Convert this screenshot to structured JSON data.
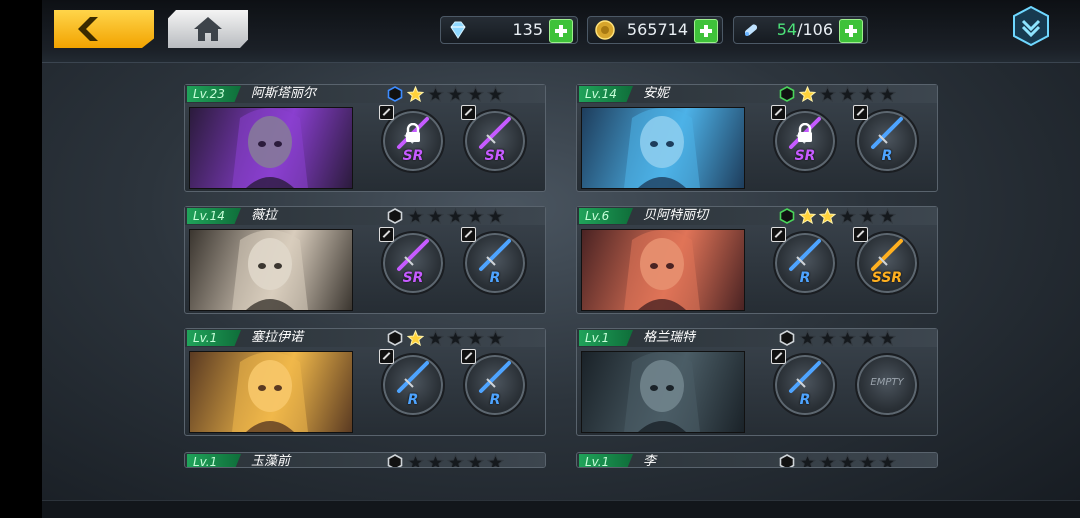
{
  "topbar": {
    "diamonds": "135",
    "gold": "565714",
    "capacity_current": "54",
    "capacity_max": "/106"
  },
  "colors": {
    "accent": "#f2a300",
    "level_green": "#20a35a",
    "plus_green": "#3fc23a"
  },
  "icons": [
    "back-arrow-icon",
    "home-icon",
    "diamond-icon",
    "gold-coin-icon",
    "capacity-icon",
    "plus-icon",
    "menu-chevron-icon",
    "lock-icon",
    "edit-icon",
    "star-icon",
    "element-hexagon-icon"
  ],
  "cards": [
    {
      "level": "Lv.23",
      "name": "阿斯塔丽尔",
      "stars": 1,
      "element_color": "#3d8cff",
      "slots": [
        {
          "rarity": "SR",
          "locked": true
        },
        {
          "rarity": "SR",
          "locked": false
        }
      ]
    },
    {
      "level": "Lv.14",
      "name": "安妮",
      "stars": 1,
      "element_color": "#4ad45a",
      "slots": [
        {
          "rarity": "SR",
          "locked": true
        },
        {
          "rarity": "R",
          "locked": false
        }
      ]
    },
    {
      "level": "Lv.14",
      "name": "薇拉",
      "stars": 0,
      "element_color": "#222",
      "slots": [
        {
          "rarity": "SR",
          "locked": false
        },
        {
          "rarity": "R",
          "locked": false
        }
      ]
    },
    {
      "level": "Lv.6",
      "name": "贝阿特丽切",
      "stars": 2,
      "element_color": "#4ad45a",
      "slots": [
        {
          "rarity": "R",
          "locked": false
        },
        {
          "rarity": "SSR",
          "locked": false
        }
      ]
    },
    {
      "level": "Lv.1",
      "name": "塞拉伊诺",
      "stars": 1,
      "element_color": "#222",
      "slots": [
        {
          "rarity": "R",
          "locked": false
        },
        {
          "rarity": "R",
          "locked": false
        }
      ]
    },
    {
      "level": "Lv.1",
      "name": "格兰瑞特",
      "stars": 0,
      "element_color": "#222",
      "slots": [
        {
          "rarity": "R",
          "locked": false
        },
        {
          "rarity": "EMPTY",
          "locked": false
        }
      ]
    },
    {
      "level": "Lv.1",
      "name": "玉藻前",
      "stars": 0,
      "element_color": "#222",
      "slots": []
    },
    {
      "level": "Lv.1",
      "name": "李",
      "stars": 0,
      "element_color": "#222",
      "slots": []
    }
  ]
}
